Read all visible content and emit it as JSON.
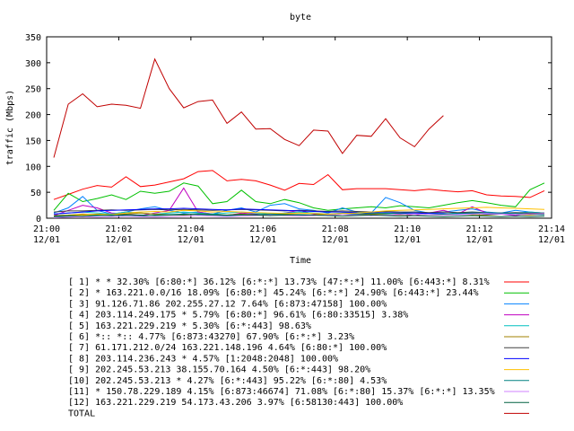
{
  "chart_data": {
    "type": "line",
    "title": "byte",
    "xlabel": "Time",
    "ylabel": "traffic (Mbps)",
    "ylim": [
      0,
      350
    ],
    "yticks": [
      0,
      50,
      100,
      150,
      200,
      250,
      300,
      350
    ],
    "xlim": [
      0,
      14
    ],
    "xticks": [
      {
        "x": 0,
        "label": [
          "21:00",
          "12/01"
        ]
      },
      {
        "x": 2,
        "label": [
          "21:02",
          "12/01"
        ]
      },
      {
        "x": 4,
        "label": [
          "21:04",
          "12/01"
        ]
      },
      {
        "x": 6,
        "label": [
          "21:06",
          "12/01"
        ]
      },
      {
        "x": 8,
        "label": [
          "21:08",
          "12/01"
        ]
      },
      {
        "x": 10,
        "label": [
          "21:10",
          "12/01"
        ]
      },
      {
        "x": 12,
        "label": [
          "21:12",
          "12/01"
        ]
      },
      {
        "x": 14,
        "label": [
          "21:14",
          "12/01"
        ]
      }
    ],
    "grid": false,
    "legend_position": "bottom",
    "x": [
      0.2,
      0.6,
      1.0,
      1.4,
      1.8,
      2.2,
      2.6,
      3.0,
      3.4,
      3.8,
      4.2,
      4.6,
      5.0,
      5.4,
      5.8,
      6.2,
      6.6,
      7.0,
      7.4,
      7.8,
      8.2,
      8.6,
      9.0,
      9.4,
      9.8,
      10.2,
      10.6,
      11.0,
      11.4,
      11.8,
      12.2,
      12.6,
      13.0,
      13.4,
      13.8
    ],
    "series": [
      {
        "name": "[ 1] * * 32.30%  [6:80:*] 36.12% [6:*:*] 13.73% [47:*:*] 11.00% [6:443:*] 8.31%",
        "color": "#ff0000",
        "values": [
          36,
          46,
          56,
          63,
          60,
          80,
          61,
          64,
          70,
          76,
          90,
          92,
          72,
          75,
          72,
          64,
          54,
          67,
          65,
          84,
          55,
          57,
          57,
          57,
          55,
          53,
          56,
          53,
          51,
          53,
          45,
          43,
          42,
          40,
          53
        ]
      },
      {
        "name": "[ 2] * 163.221.0.0/16 18.09%  [6:80:*] 45.24% [6:*:*] 24.90% [6:443:*] 23.44%",
        "color": "#00c000",
        "values": [
          15,
          48,
          32,
          38,
          45,
          36,
          52,
          48,
          52,
          68,
          62,
          28,
          32,
          54,
          32,
          28,
          36,
          30,
          20,
          15,
          18,
          20,
          22,
          20,
          24,
          22,
          20,
          25,
          30,
          34,
          30,
          25,
          22,
          55,
          68
        ]
      },
      {
        "name": "[ 3] 91.126.71.86 202.255.27.12 7.64%  [6:873:47158] 100.00%",
        "color": "#0080ff",
        "values": [
          10,
          20,
          42,
          15,
          8,
          12,
          18,
          22,
          15,
          10,
          12,
          8,
          15,
          20,
          12,
          25,
          28,
          18,
          15,
          10,
          20,
          12,
          10,
          40,
          30,
          15,
          10,
          12,
          15,
          18,
          12,
          10,
          15,
          12,
          10
        ]
      },
      {
        "name": "[ 4] 203.114.249.175 * 5.79%  [6:80:*] 96.61% [6:80:33515] 3.38%",
        "color": "#c000c0",
        "values": [
          5,
          15,
          25,
          20,
          10,
          8,
          5,
          10,
          15,
          58,
          12,
          8,
          5,
          10,
          8,
          5,
          10,
          15,
          8,
          5,
          10,
          8,
          5,
          10,
          8,
          5,
          10,
          15,
          8,
          22,
          10,
          8,
          5,
          10,
          8
        ]
      },
      {
        "name": "[ 5] 163.221.229.219 * 5.30%  [6:*:443] 98.63%",
        "color": "#00c0c0",
        "values": [
          8,
          10,
          12,
          10,
          8,
          12,
          10,
          8,
          10,
          12,
          10,
          8,
          10,
          12,
          10,
          8,
          10,
          12,
          10,
          8,
          10,
          12,
          10,
          8,
          10,
          12,
          10,
          8,
          10,
          12,
          10,
          8,
          10,
          12,
          10
        ]
      },
      {
        "name": "[ 6] *:: *:: 4.77%  [6:873:43270] 67.90% [6:*:*] 3.23%",
        "color": "#a08000",
        "values": [
          5,
          6,
          8,
          7,
          6,
          8,
          10,
          8,
          7,
          6,
          8,
          7,
          6,
          8,
          7,
          6,
          8,
          7,
          6,
          8,
          7,
          6,
          8,
          7,
          6,
          8,
          7,
          6,
          8,
          7,
          6,
          8,
          7,
          6,
          8
        ]
      },
      {
        "name": "[ 7] 61.171.212.0/24 163.221.148.196 4.64%  [6:80:*] 100.00%",
        "color": "#404040",
        "values": [
          12,
          14,
          14,
          15,
          16,
          15,
          16,
          17,
          16,
          17,
          16,
          15,
          16,
          17,
          16,
          15,
          14,
          15,
          14,
          13,
          14,
          13,
          12,
          13,
          12,
          12,
          11,
          12,
          11,
          12,
          11,
          10,
          11,
          10,
          10
        ]
      },
      {
        "name": "[ 8] 203.114.236.243 * 4.57%  [1:2048:2048] 100.00%",
        "color": "#0000ff",
        "values": [
          8,
          10,
          12,
          14,
          15,
          16,
          17,
          18,
          18,
          19,
          18,
          17,
          16,
          18,
          17,
          16,
          15,
          14,
          13,
          12,
          12,
          11,
          10,
          11,
          10,
          10,
          9,
          9,
          8,
          9,
          8,
          8,
          7,
          8,
          7
        ]
      },
      {
        "name": "[ 9] 202.245.53.213 38.155.70.164 4.50%  [6:*:443] 98.20%",
        "color": "#ffc000",
        "values": [
          3,
          5,
          6,
          8,
          7,
          10,
          12,
          13,
          12,
          15,
          14,
          12,
          13,
          12,
          11,
          10,
          9,
          10,
          9,
          8,
          9,
          10,
          12,
          14,
          15,
          16,
          17,
          18,
          19,
          20,
          21,
          20,
          19,
          18,
          17
        ]
      },
      {
        "name": "[10] 202.245.53.213 * 4.27%  [6:*:443] 95.22% [6:*:80] 4.53%",
        "color": "#008080",
        "values": [
          2,
          3,
          4,
          5,
          6,
          5,
          4,
          6,
          7,
          8,
          7,
          6,
          5,
          6,
          7,
          8,
          7,
          6,
          5,
          6,
          7,
          8,
          9,
          10,
          9,
          8,
          7,
          8,
          9,
          10,
          11,
          10,
          9,
          8,
          7
        ]
      },
      {
        "name": "[11] * 150.78.229.189 4.15%  [6:873:46674] 71.08% [6:*:80] 15.37% [6:*:*] 13.35%",
        "color": "#d080ff",
        "values": [
          1,
          2,
          3,
          2,
          3,
          4,
          3,
          2,
          3,
          4,
          5,
          4,
          3,
          4,
          5,
          6,
          5,
          4,
          5,
          6,
          7,
          6,
          5,
          6,
          7,
          8,
          7,
          6,
          7,
          8,
          9,
          8,
          7,
          8,
          9
        ]
      },
      {
        "name": "[12] 163.221.229.219 54.173.43.206 3.97%  [6:58130:443] 100.00%",
        "color": "#006040",
        "values": [
          4,
          5,
          4,
          6,
          5,
          7,
          6,
          5,
          6,
          7,
          8,
          7,
          6,
          7,
          6,
          5,
          6,
          7,
          6,
          5,
          4,
          5,
          6,
          5,
          4,
          5,
          4,
          3,
          4,
          5,
          4,
          3,
          4,
          3,
          4
        ]
      },
      {
        "name": "TOTAL",
        "color": "#c00000",
        "values": [
          117,
          220,
          240,
          215,
          220,
          218,
          212,
          307,
          250,
          213,
          225,
          228,
          183,
          205,
          172,
          173,
          152,
          140,
          170,
          168,
          125,
          160,
          158,
          192,
          155,
          138,
          172,
          198,
          0,
          0,
          0,
          0,
          0,
          0,
          0
        ],
        "x_override": [
          0.2,
          0.6,
          1.0,
          1.4,
          1.8,
          2.2,
          2.6,
          3.0,
          3.4,
          3.8,
          4.2,
          4.6,
          5.0,
          5.4,
          5.8,
          6.2,
          6.6,
          7.0,
          7.4,
          7.8,
          8.2,
          8.6,
          9.0,
          9.4,
          9.8,
          10.2,
          10.6,
          11.0
        ]
      }
    ]
  }
}
